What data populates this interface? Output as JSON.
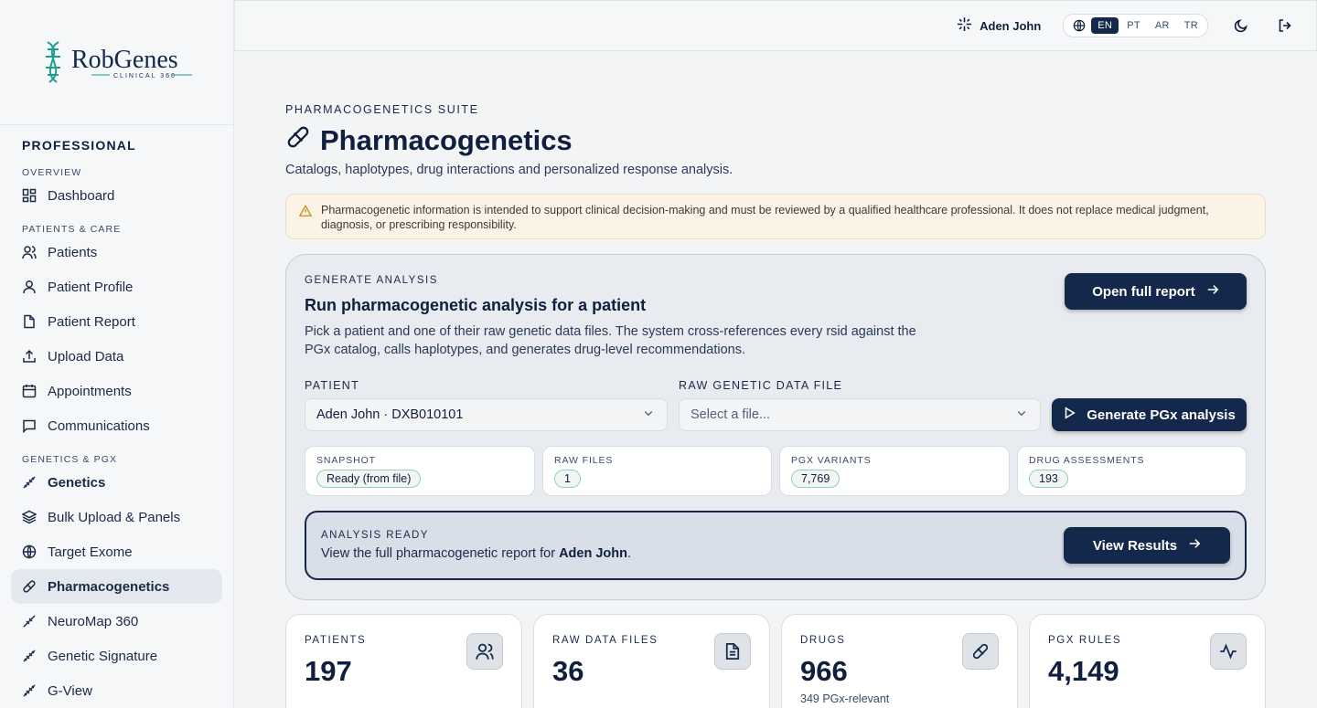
{
  "sidebar": {
    "brand_name": "RobGenes",
    "brand_sub": "CLINICAL 360",
    "org": "PROFESSIONAL",
    "sections": [
      {
        "title": "OVERVIEW",
        "items": [
          {
            "label": "Dashboard",
            "icon": "dashboard-icon"
          }
        ]
      },
      {
        "title": "PATIENTS & CARE",
        "items": [
          {
            "label": "Patients",
            "icon": "users-icon"
          },
          {
            "label": "Patient Profile",
            "icon": "user-icon"
          },
          {
            "label": "Patient Report",
            "icon": "file-icon"
          },
          {
            "label": "Upload Data",
            "icon": "upload-icon"
          },
          {
            "label": "Appointments",
            "icon": "calendar-icon"
          },
          {
            "label": "Communications",
            "icon": "message-icon"
          }
        ]
      },
      {
        "title": "GENETICS & PGX",
        "items": [
          {
            "label": "Genetics",
            "icon": "dna-icon"
          },
          {
            "label": "Bulk Upload & Panels",
            "icon": "layers-icon"
          },
          {
            "label": "Target Exome",
            "icon": "target-icon"
          },
          {
            "label": "Pharmacogenetics",
            "icon": "pill-icon"
          },
          {
            "label": "NeuroMap 360",
            "icon": "map-icon"
          },
          {
            "label": "Genetic Signature",
            "icon": "dna-icon"
          },
          {
            "label": "G-View",
            "icon": "dna-icon"
          }
        ]
      }
    ]
  },
  "topbar": {
    "user_name": "Aden John",
    "languages": [
      "EN",
      "PT",
      "AR",
      "TR"
    ],
    "active_language": "EN"
  },
  "page": {
    "eyebrow": "PHARMACOGENETICS SUITE",
    "title": "Pharmacogenetics",
    "subtitle": "Catalogs, haplotypes, drug interactions and personalized response analysis.",
    "warning": "Pharmacogenetic information is intended to support clinical decision-making and must be reviewed by a qualified healthcare professional. It does not replace medical judgment, diagnosis, or prescribing responsibility."
  },
  "analysis": {
    "eyebrow": "GENERATE ANALYSIS",
    "title": "Run pharmacogenetic analysis for a patient",
    "description": "Pick a patient and one of their raw genetic data files. The system cross-references every rsid against the PGx catalog, calls haplotypes, and generates drug-level recommendations.",
    "open_report_label": "Open full report",
    "patient_label": "PATIENT",
    "patient_value": "Aden John · DXB010101",
    "file_label": "RAW GENETIC DATA FILE",
    "file_placeholder": "Select a file...",
    "generate_label": "Generate PGx analysis",
    "stats": [
      {
        "label": "SNAPSHOT",
        "value": "Ready (from file)"
      },
      {
        "label": "RAW FILES",
        "value": "1"
      },
      {
        "label": "PGX VARIANTS",
        "value": "7,769"
      },
      {
        "label": "DRUG ASSESSMENTS",
        "value": "193"
      }
    ],
    "ready": {
      "eyebrow": "ANALYSIS READY",
      "text_before": "View the full pharmacogenetic report for ",
      "patient": "Aden John",
      "text_after": ".",
      "button": "View Results"
    }
  },
  "kpis": [
    {
      "label": "PATIENTS",
      "value": "197",
      "sub": "",
      "icon": "users-icon"
    },
    {
      "label": "RAW DATA FILES",
      "value": "36",
      "sub": "",
      "icon": "file-icon"
    },
    {
      "label": "DRUGS",
      "value": "966",
      "sub": "349 PGx-relevant",
      "icon": "pill-icon"
    },
    {
      "label": "PGX RULES",
      "value": "4,149",
      "sub": "",
      "icon": "activity-icon"
    }
  ]
}
